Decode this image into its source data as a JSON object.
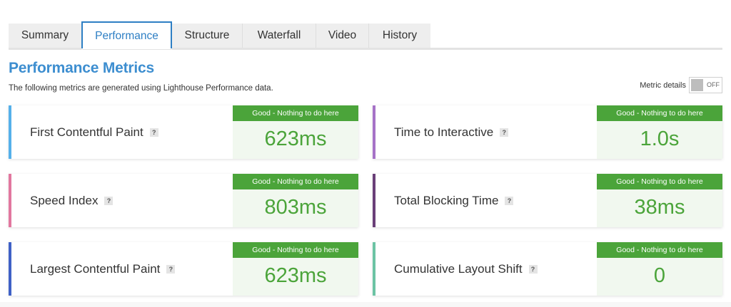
{
  "tabs": [
    {
      "label": "Summary",
      "active": false
    },
    {
      "label": "Performance",
      "active": true
    },
    {
      "label": "Structure",
      "active": false
    },
    {
      "label": "Waterfall",
      "active": false
    },
    {
      "label": "Video",
      "active": false
    },
    {
      "label": "History",
      "active": false
    }
  ],
  "header": {
    "title": "Performance Metrics",
    "description": "The following metrics are generated using Lighthouse Performance data."
  },
  "metric_details_toggle": {
    "label": "Metric details",
    "state": "OFF"
  },
  "help_symbol": "?",
  "metrics": [
    {
      "name": "First Contentful Paint",
      "grade": "Good - Nothing to do here",
      "value": "623ms",
      "accent": "#55b0ea"
    },
    {
      "name": "Time to Interactive",
      "grade": "Good - Nothing to do here",
      "value": "1.0s",
      "accent": "#a672c7"
    },
    {
      "name": "Speed Index",
      "grade": "Good - Nothing to do here",
      "value": "803ms",
      "accent": "#e2779f"
    },
    {
      "name": "Total Blocking Time",
      "grade": "Good - Nothing to do here",
      "value": "38ms",
      "accent": "#6a3f78"
    },
    {
      "name": "Largest Contentful Paint",
      "grade": "Good - Nothing to do here",
      "value": "623ms",
      "accent": "#3f61c6"
    },
    {
      "name": "Cumulative Layout Shift",
      "grade": "Good - Nothing to do here",
      "value": "0",
      "accent": "#6cc3a4"
    }
  ],
  "colors": {
    "good_green": "#4ba43a",
    "title_blue": "#3d8ed0",
    "active_tab_blue": "#2e7fc4"
  }
}
